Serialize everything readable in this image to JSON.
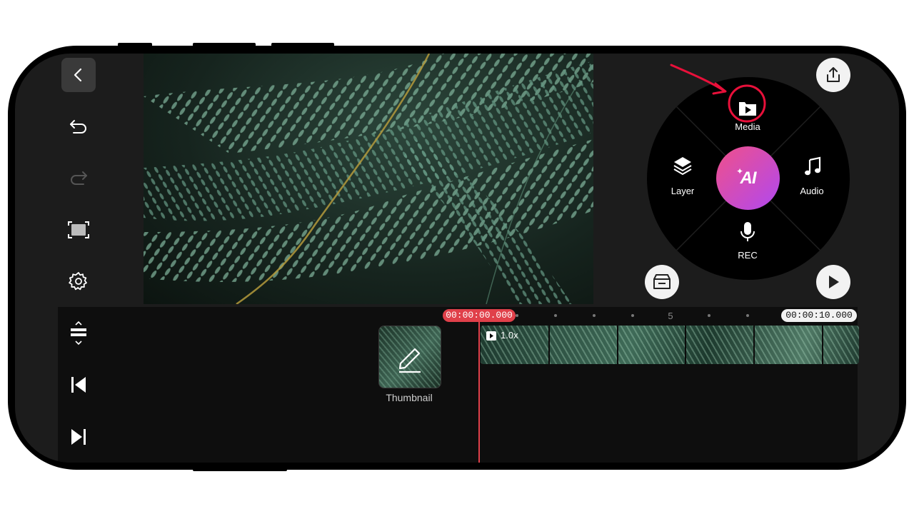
{
  "preview": {
    "image_desc": "fern"
  },
  "left_toolbar": {
    "back_icon": "chevron-left-icon",
    "undo_icon": "undo-icon",
    "redo_icon": "redo-icon",
    "fullscreen_icon": "fullscreen-icon",
    "settings_icon": "gear-icon",
    "height_icon": "track-height-icon",
    "start_icon": "skip-start-icon",
    "end_icon": "skip-end-icon"
  },
  "radial_menu": {
    "media": "Media",
    "layer": "Layer",
    "audio": "Audio",
    "rec": "REC",
    "ai": "AI"
  },
  "timeline": {
    "current_time": "00:00:00.000",
    "end_time": "00:00:10.000",
    "ruler_mark": "5",
    "clip_speed": "1.0x",
    "thumbnail_label": "Thumbnail"
  },
  "colors": {
    "accent_red": "#e0404a",
    "annotation_red": "#e8103a",
    "ai_gradient_start": "#f0508a",
    "ai_gradient_end": "#b048f0"
  }
}
